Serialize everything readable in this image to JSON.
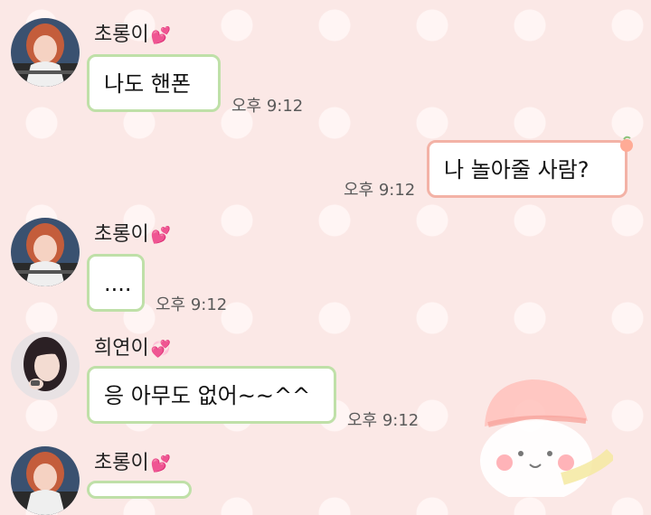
{
  "messages": [
    {
      "sender": "초롱이",
      "text": "나도 핸폰",
      "time": "오후 9:12"
    },
    {
      "text": "나 놀아줄 사람?",
      "time": "오후 9:12"
    },
    {
      "sender": "초롱이",
      "text": "....",
      "time": "오후 9:12"
    },
    {
      "sender": "희연이",
      "text": "응 아무도 없어~~^^",
      "time": "오후 9:12"
    },
    {
      "sender": "초롱이"
    }
  ],
  "colors": {
    "background": "#fbe8e6",
    "received_border": "#bfe0a8",
    "sent_border": "#f3b2a6",
    "heart": "#ff3d8b"
  },
  "icons": [
    "heart-icon",
    "sparkle-hearts-icon",
    "peach-icon",
    "character-illustration"
  ]
}
